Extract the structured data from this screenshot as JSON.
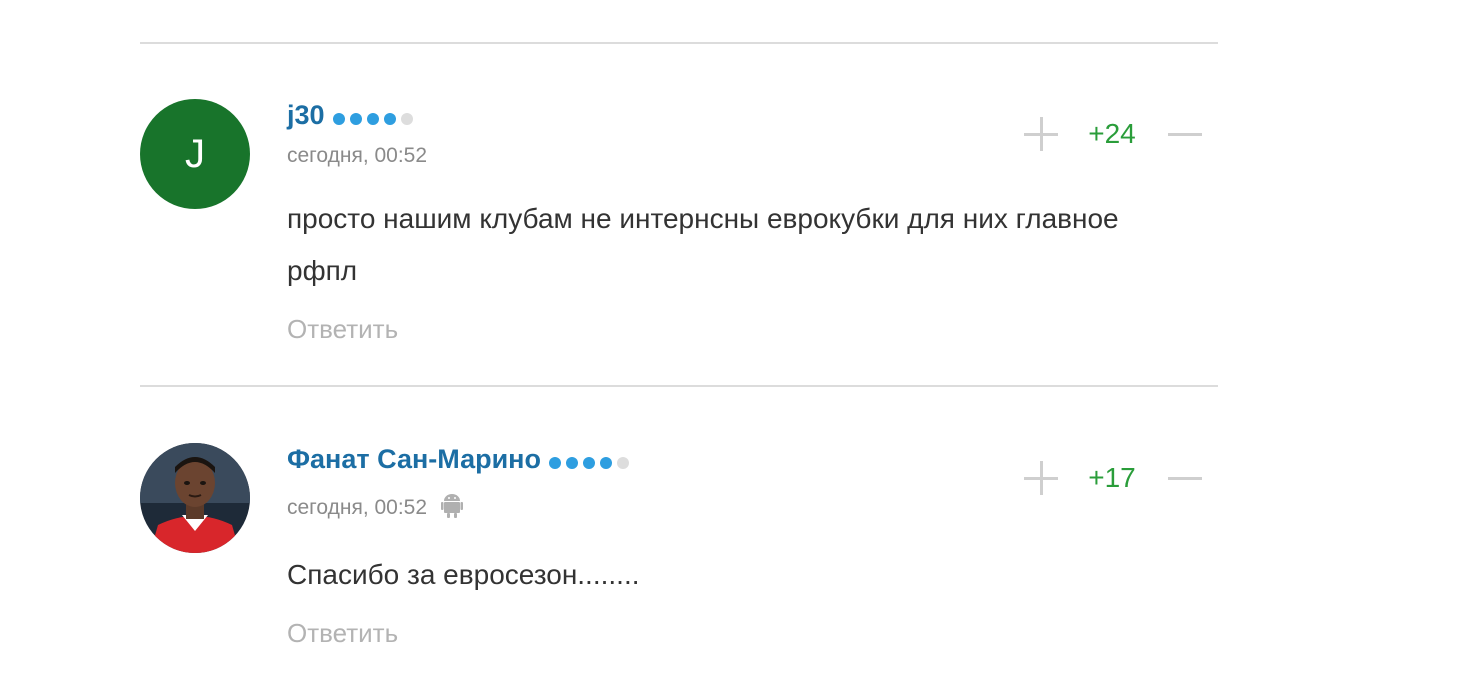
{
  "comments": [
    {
      "author": "j30",
      "avatar_letter": "J",
      "avatar_color": "#18742b",
      "rating_dots": 4,
      "rating_max": 5,
      "time": "сегодня, 00:52",
      "text": "просто нашим клубам не интернсны еврокубки для них главное рфпл",
      "score": "+24",
      "reply_label": "Ответить"
    },
    {
      "author": "Фанат Сан-Марино",
      "avatar_icon": "player-photo-avatar",
      "rating_dots": 4,
      "rating_max": 5,
      "time": "сегодня, 00:52",
      "device_icon": "android-icon",
      "text": "Спасибо за евросезон........",
      "score": "+17",
      "reply_label": "Ответить"
    }
  ],
  "colors": {
    "author": "#1c6ea4",
    "score_positive": "#2a9d3a",
    "rating_dot": "#2e9ee0",
    "divider": "#dcdcdc"
  }
}
